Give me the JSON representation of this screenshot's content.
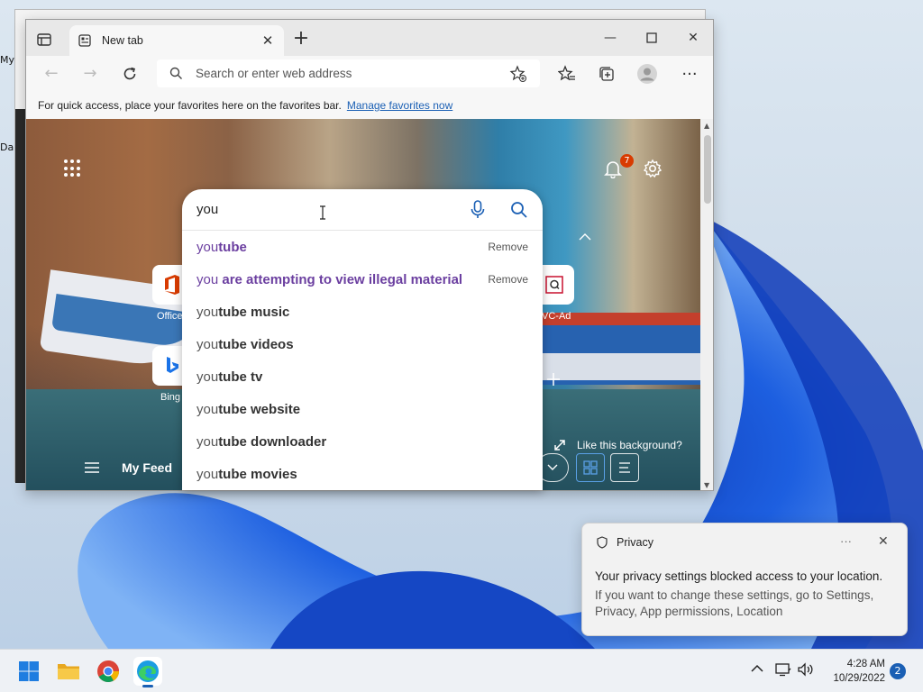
{
  "desktop": {
    "icon_labels": [
      "My",
      "Da"
    ]
  },
  "browser": {
    "tab": {
      "title": "New tab"
    },
    "address_bar": {
      "placeholder": "Search or enter web address"
    },
    "favorites_bar": {
      "message": "For quick access, place your favorites here on the favorites bar.",
      "link": "Manage favorites now"
    }
  },
  "new_tab_page": {
    "notification_count": "7",
    "search": {
      "value": "you",
      "suggestions": [
        {
          "typed": "you",
          "rest": "tube",
          "history": true,
          "action": "Remove"
        },
        {
          "typed": "you",
          "rest": " are attempting to view illegal material",
          "history": true,
          "action": "Remove"
        },
        {
          "typed": "you",
          "rest": "tube music",
          "history": false,
          "action": ""
        },
        {
          "typed": "you",
          "rest": "tube videos",
          "history": false,
          "action": ""
        },
        {
          "typed": "you",
          "rest": "tube tv",
          "history": false,
          "action": ""
        },
        {
          "typed": "you",
          "rest": "tube website",
          "history": false,
          "action": ""
        },
        {
          "typed": "you",
          "rest": "tube downloader",
          "history": false,
          "action": ""
        },
        {
          "typed": "you",
          "rest": "tube movies",
          "history": false,
          "action": ""
        }
      ]
    },
    "tiles": [
      {
        "label": "Office"
      },
      {
        "label": "Bing"
      },
      {
        "label": "VC-Ad"
      }
    ],
    "feed_label": "My Feed",
    "like_background": "Like this background?"
  },
  "toast": {
    "title": "Privacy",
    "more": "···",
    "message": "Your privacy settings blocked access to your location.",
    "detail": "If you want to change these settings, go to Settings, Privacy, App permissions, Location"
  },
  "taskbar": {
    "time": "4:28 AM",
    "date": "10/29/2022",
    "notification_count": "2"
  }
}
